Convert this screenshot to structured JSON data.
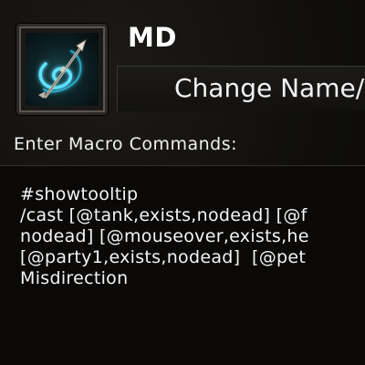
{
  "macro": {
    "name": "MD",
    "icon": "misdirection-arrow-icon"
  },
  "buttons": {
    "change_name": "Change Name/"
  },
  "editor": {
    "label": "Enter Macro Commands:",
    "lines": [
      "#showtooltip",
      "/cast [@tank,exists,nodead] [@f",
      "nodead] [@mouseover,exists,he",
      "[@party1,exists,nodead]  [@pet",
      "Misdirection"
    ]
  },
  "colors": {
    "background": "#100f0d",
    "text": "#ffffff",
    "icon_glow": "#5fe3ff"
  }
}
